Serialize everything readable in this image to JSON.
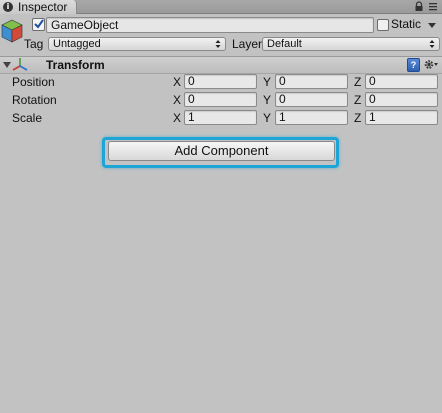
{
  "window": {
    "tab_label": "Inspector"
  },
  "gameobject": {
    "name": "GameObject",
    "static_label": "Static",
    "tag_label": "Tag",
    "tag_value": "Untagged",
    "layer_label": "Layer",
    "layer_value": "Default"
  },
  "transform": {
    "title": "Transform",
    "help_glyph": "?",
    "rows": [
      {
        "label": "Position",
        "x": "0",
        "y": "0",
        "z": "0"
      },
      {
        "label": "Rotation",
        "x": "0",
        "y": "0",
        "z": "0"
      },
      {
        "label": "Scale",
        "x": "1",
        "y": "1",
        "z": "1"
      }
    ],
    "axis_labels": {
      "x": "X",
      "y": "Y",
      "z": "Z"
    }
  },
  "add_component_label": "Add Component",
  "colors": {
    "background": "#c2c2c2",
    "highlight": "#1ea5d8"
  },
  "icons": [
    "info-icon",
    "lock-icon",
    "menu-icon",
    "gameobject-cube-icon",
    "checkmark-icon",
    "dropdown-arrow-icon",
    "foldout-arrow-icon",
    "transform-icon",
    "help-icon",
    "gear-icon"
  ]
}
